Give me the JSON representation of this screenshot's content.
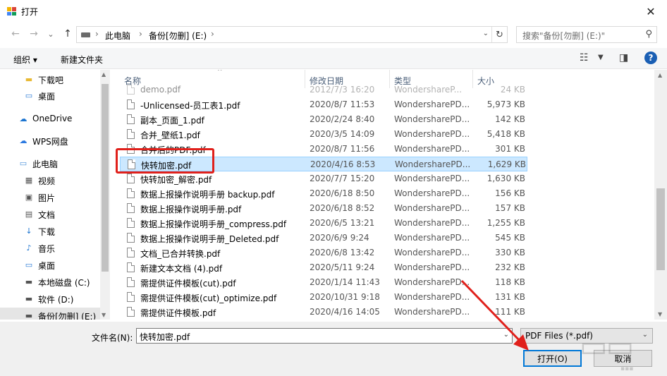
{
  "window": {
    "title": "打开",
    "close_glyph": "✕"
  },
  "nav": {
    "back": "←",
    "forward": "→",
    "recent": "⌄",
    "up": "↑",
    "breadcrumb": [
      "此电脑",
      "备份[勿删] (E:)"
    ],
    "search_placeholder": "搜索\"备份[勿删] (E:)\""
  },
  "toolbar": {
    "organize": "组织 ▾",
    "new_folder": "新建文件夹"
  },
  "sidebar": {
    "items": [
      {
        "label": "下载吧",
        "icon": "folder-icon",
        "color": "#e8b934"
      },
      {
        "label": "桌面",
        "icon": "desktop-icon",
        "color": "#2a7ad4"
      },
      {
        "label": "OneDrive",
        "icon": "cloud-icon",
        "color": "#1b74d0"
      },
      {
        "label": "WPS网盘",
        "icon": "cloud-icon",
        "color": "#2b79e0"
      },
      {
        "label": "此电脑",
        "icon": "computer-icon",
        "color": "#4a90d9"
      },
      {
        "label": "视频",
        "icon": "video-icon",
        "color": "#555555"
      },
      {
        "label": "图片",
        "icon": "picture-icon",
        "color": "#555555"
      },
      {
        "label": "文档",
        "icon": "document-icon",
        "color": "#555555"
      },
      {
        "label": "下载",
        "icon": "download-icon",
        "color": "#1b74d0"
      },
      {
        "label": "音乐",
        "icon": "music-icon",
        "color": "#1b74d0"
      },
      {
        "label": "桌面",
        "icon": "desktop-icon",
        "color": "#2a7ad4"
      },
      {
        "label": "本地磁盘 (C:)",
        "icon": "drive-icon",
        "color": "#555555"
      },
      {
        "label": "软件 (D:)",
        "icon": "drive-icon",
        "color": "#555555"
      },
      {
        "label": "备份[勿删] (E:)",
        "icon": "drive-icon",
        "color": "#555555"
      }
    ]
  },
  "columns": {
    "name": "名称",
    "date": "修改日期",
    "type": "类型",
    "size": "大小"
  },
  "files": [
    {
      "name": "demo.pdf",
      "date": "2012/7/3 16:20",
      "type": "WondershareP...",
      "size": "24 KB"
    },
    {
      "name": "-Unlicensed-员工表1.pdf",
      "date": "2020/8/7 11:53",
      "type": "WondersharePD...",
      "size": "5,973 KB"
    },
    {
      "name": "副本_页面_1.pdf",
      "date": "2020/2/24 8:40",
      "type": "WondersharePD...",
      "size": "142 KB"
    },
    {
      "name": "合并_壁纸1.pdf",
      "date": "2020/3/5 14:09",
      "type": "WondersharePD...",
      "size": "5,418 KB"
    },
    {
      "name": "合并后的PDF.pdf",
      "date": "2020/8/7 11:56",
      "type": "WondersharePD...",
      "size": "301 KB"
    },
    {
      "name": "快转加密.pdf",
      "date": "2020/4/16 8:53",
      "type": "WondersharePD...",
      "size": "1,629 KB"
    },
    {
      "name": "快转加密_解密.pdf",
      "date": "2020/7/7 15:20",
      "type": "WondersharePD...",
      "size": "1,630 KB"
    },
    {
      "name": "数据上报操作说明手册 backup.pdf",
      "date": "2020/6/18 8:50",
      "type": "WondersharePD...",
      "size": "156 KB"
    },
    {
      "name": "数据上报操作说明手册.pdf",
      "date": "2020/6/18 8:52",
      "type": "WondersharePD...",
      "size": "157 KB"
    },
    {
      "name": "数据上报操作说明手册_compress.pdf",
      "date": "2020/6/5 13:21",
      "type": "WondersharePD...",
      "size": "1,255 KB"
    },
    {
      "name": "数据上报操作说明手册_Deleted.pdf",
      "date": "2020/6/9 9:24",
      "type": "WondersharePD...",
      "size": "545 KB"
    },
    {
      "name": "文档_已合并转换.pdf",
      "date": "2020/6/8 13:42",
      "type": "WondersharePD...",
      "size": "330 KB"
    },
    {
      "name": "新建文本文档 (4).pdf",
      "date": "2020/5/11 9:24",
      "type": "WondersharePD...",
      "size": "232 KB"
    },
    {
      "name": "需提供证件模板(cut).pdf",
      "date": "2020/1/14 11:43",
      "type": "WondersharePD...",
      "size": "118 KB"
    },
    {
      "name": "需提供证件模板(cut)_optimize.pdf",
      "date": "2020/10/31 9:18",
      "type": "WondersharePD...",
      "size": "131 KB"
    },
    {
      "name": "需提供证件模板.pdf",
      "date": "2020/4/16 14:05",
      "type": "WondersharePD...",
      "size": "111 KB"
    }
  ],
  "bottom": {
    "filename_label": "文件名(N):",
    "filename_value": "快转加密.pdf",
    "filter_value": "PDF Files (*.pdf)",
    "open_button": "打开(O)",
    "cancel_button": "取消"
  },
  "colors": {
    "selection_bg": "#cce8ff",
    "selection_border": "#99d1ff",
    "annotation_red": "#e0201b",
    "accent_blue": "#0078d7"
  }
}
